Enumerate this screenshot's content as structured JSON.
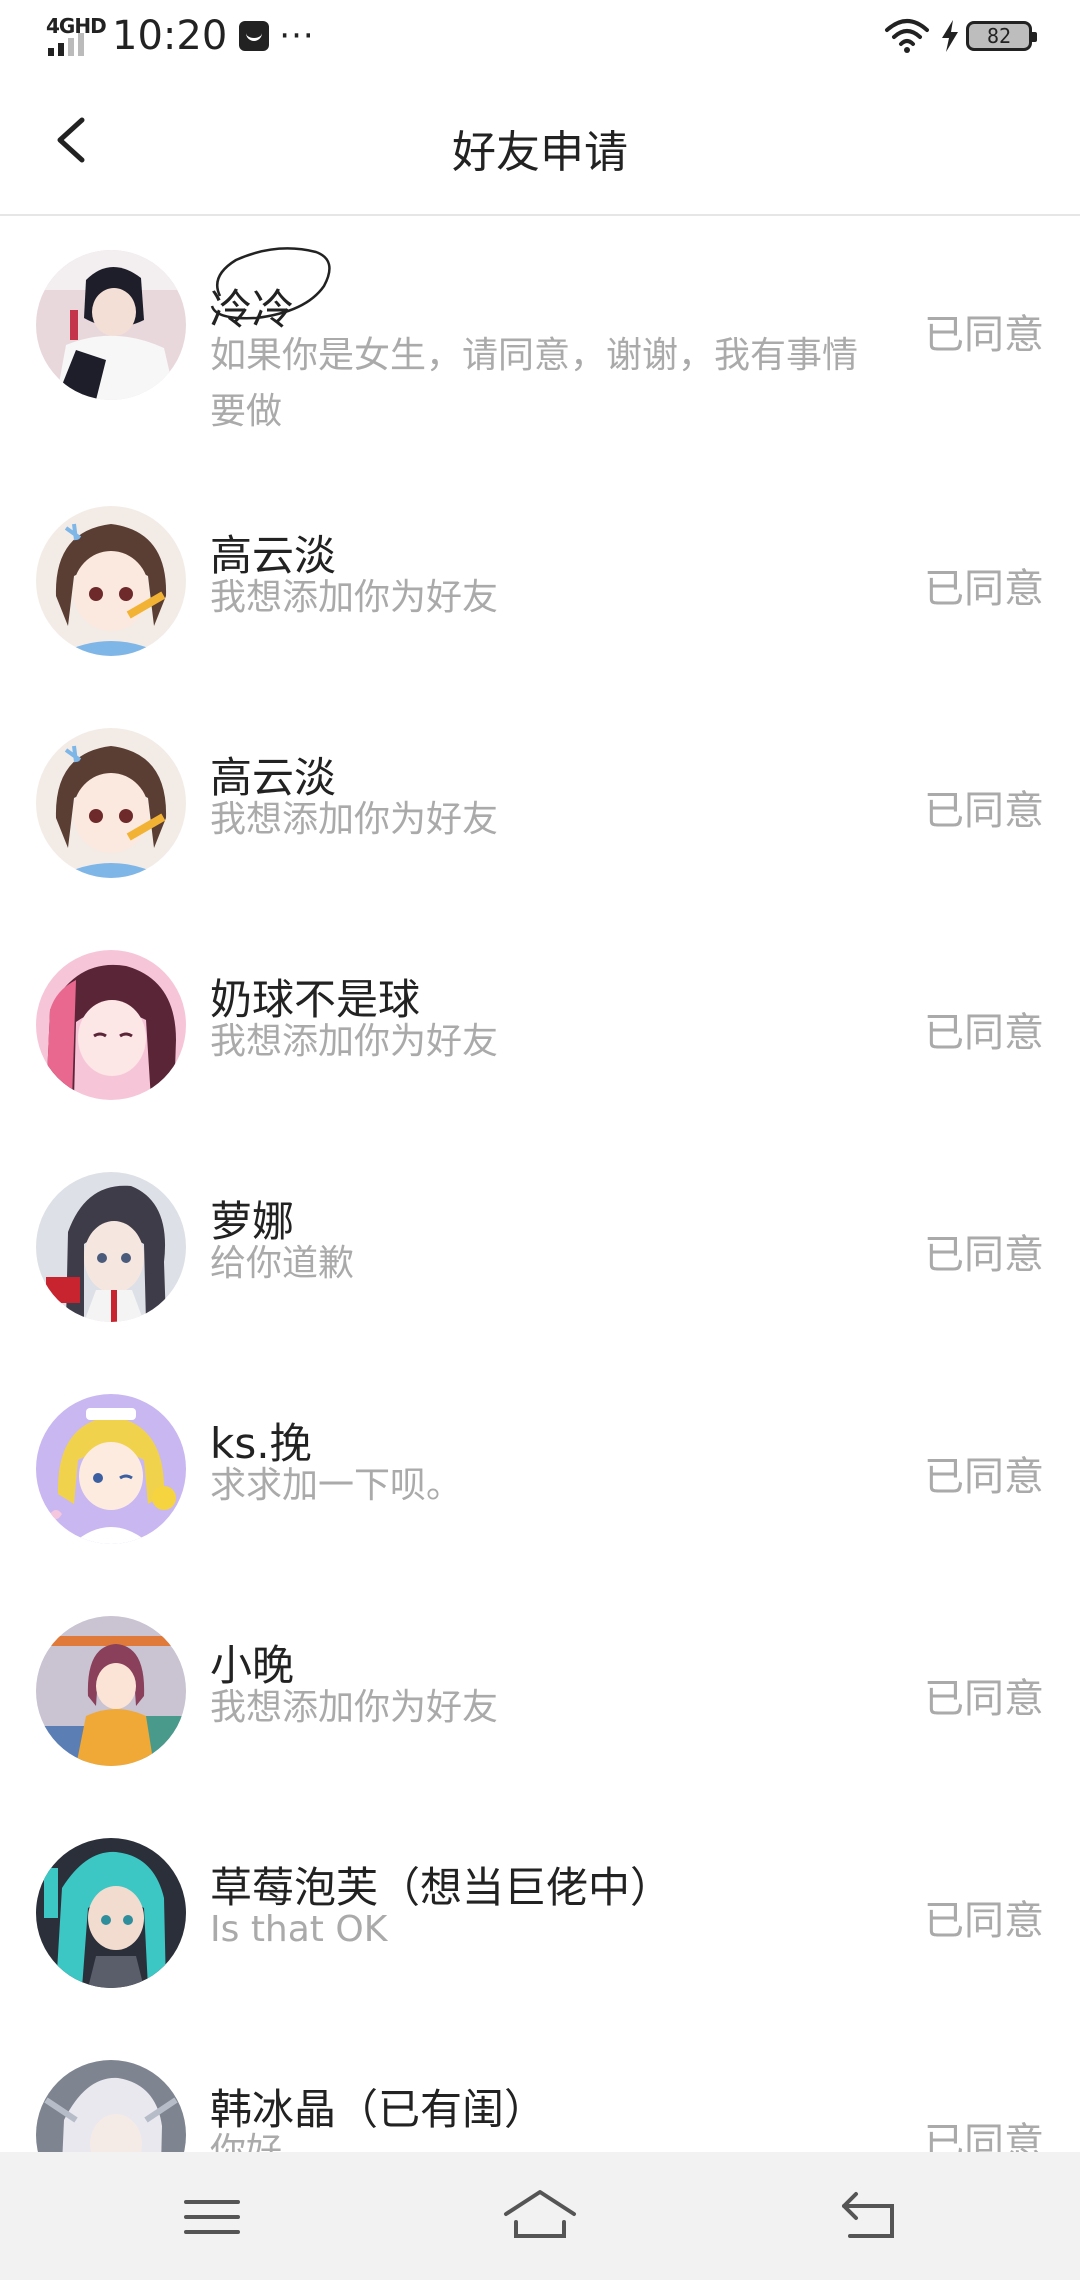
{
  "status_bar": {
    "network": "4GHD",
    "time": "10:20",
    "more": "···",
    "battery": "82"
  },
  "header": {
    "title": "好友申请"
  },
  "requests": [
    {
      "name": "冷冷",
      "message": "如果你是女生，请同意，谢谢，我有事情要做",
      "status": "已同意",
      "avatar_colors": [
        "#e8d8dc",
        "#1e1e2a",
        "#c4344a"
      ]
    },
    {
      "name": "高云淡",
      "message": "我想添加你为好友",
      "status": "已同意",
      "avatar_colors": [
        "#f3ece6",
        "#5a3e33",
        "#7fb6e8"
      ]
    },
    {
      "name": "高云淡",
      "message": "我想添加你为好友",
      "status": "已同意",
      "avatar_colors": [
        "#f3ece6",
        "#5a3e33",
        "#7fb6e8"
      ]
    },
    {
      "name": "奶球不是球",
      "message": "我想添加你为好友",
      "status": "已同意",
      "avatar_colors": [
        "#f6c6d8",
        "#5b2538",
        "#e8688f"
      ]
    },
    {
      "name": "萝娜",
      "message": "给你道歉",
      "status": "已同意",
      "avatar_colors": [
        "#dde0e6",
        "#3e3c48",
        "#c8242f"
      ]
    },
    {
      "name": "ks.挽",
      "message": "求求加一下呗。",
      "status": "已同意",
      "avatar_colors": [
        "#c9b7f1",
        "#f1d24c",
        "#f4c7de"
      ]
    },
    {
      "name": "小晚",
      "message": "我想添加你为好友",
      "status": "已同意",
      "avatar_colors": [
        "#c9c3d2",
        "#8a3f5a",
        "#f0a936"
      ]
    },
    {
      "name": "草莓泡芙（想当巨佬中）",
      "message": "Is that OK",
      "status": "已同意",
      "avatar_colors": [
        "#2b2f3a",
        "#3cc6c4",
        "#f2dccf"
      ]
    },
    {
      "name": "韩冰晶（已有闺）",
      "message": "你好",
      "status": "已同意",
      "avatar_colors": [
        "#7f8590",
        "#e8e8ee",
        "#b6bcc8"
      ]
    }
  ],
  "icons": {
    "back": "chevron-left-icon",
    "menu": "menu-icon",
    "home": "home-icon",
    "return": "return-icon"
  }
}
